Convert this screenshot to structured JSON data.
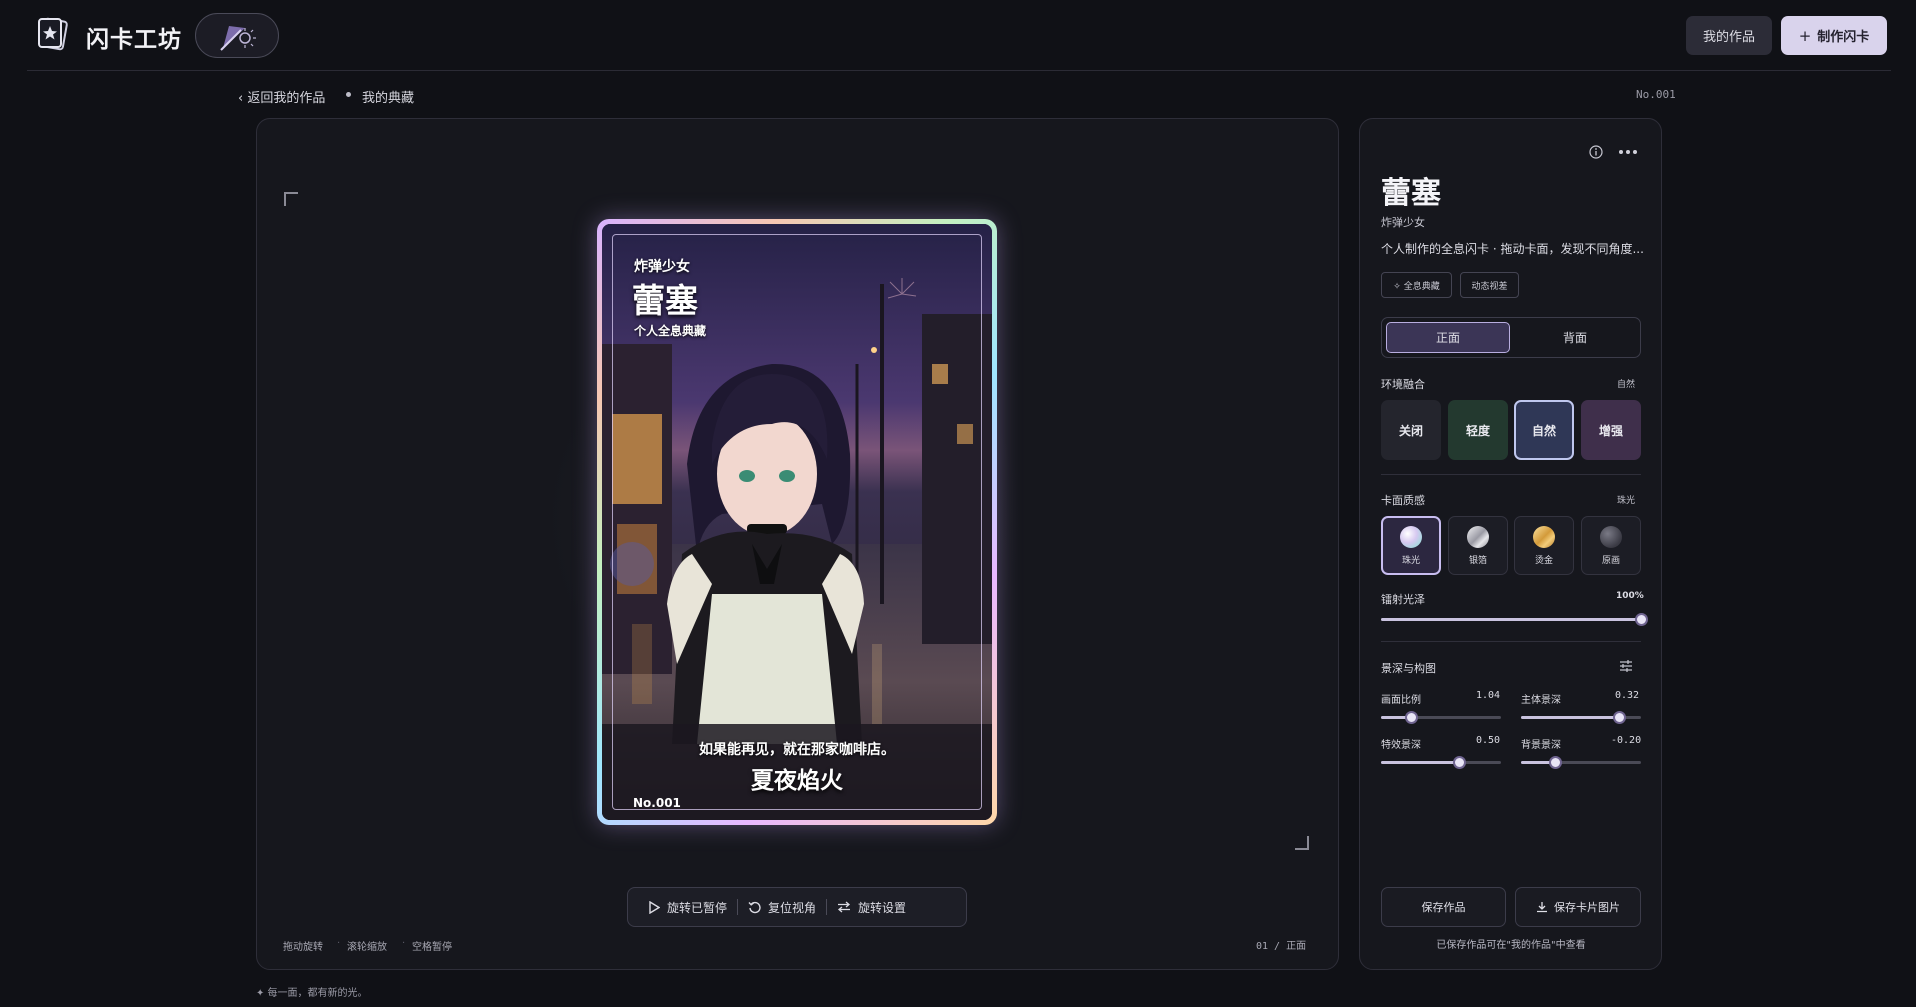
{
  "header": {
    "app_title": "闪卡工坊",
    "logo_icon": "card-star-icon",
    "theme_icon": "moon-sun-icon",
    "my_works_label": "我的作品",
    "create_label": "制作闪卡",
    "create_icon": "plus-icon"
  },
  "breadcrumb": {
    "back_label": "‹ 返回我的作品",
    "current_label": "我的典藏",
    "card_number": "No.001"
  },
  "card": {
    "subtitle": "炸弹少女",
    "name": "蕾塞",
    "collection": "个人全息典藏",
    "quote": "如果能再见，就在那家咖啡店。",
    "title": "夏夜焰火",
    "number": "No.001"
  },
  "toolbar": {
    "play_label": "旋转已暂停",
    "reset_label": "复位视角",
    "settings_label": "旋转设置"
  },
  "hints": {
    "drag": "拖动旋转",
    "scroll": "滚轮缩放",
    "space": "空格暂停",
    "sep": "·"
  },
  "page_indicator": "01 / 正面",
  "footer_tagline": "✦  每一面，都有新的光。",
  "panel": {
    "name": "蕾塞",
    "subtitle": "炸弹少女",
    "description": "个人制作的全息闪卡 · 拖动卡面，发现不同角度...",
    "tags": [
      "✧ 全息典藏",
      "动态视差"
    ],
    "side_options": [
      "正面",
      "背面"
    ],
    "side_selected": "正面",
    "env": {
      "label": "环境融合",
      "value": "自然",
      "options": [
        "关闭",
        "轻度",
        "自然",
        "增强"
      ]
    },
    "texture": {
      "label": "卡面质感",
      "value": "珠光",
      "options": [
        "珠光",
        "银箔",
        "烫金",
        "原画"
      ]
    },
    "gloss": {
      "label": "镭射光泽",
      "value": "100%",
      "fraction": 1.0
    },
    "depth": {
      "label": "景深与构图",
      "ratio": {
        "label": "画面比例",
        "value": "1.04",
        "fraction": 0.25
      },
      "subject": {
        "label": "主体景深",
        "value": "0.32",
        "fraction": 0.82
      },
      "effect": {
        "label": "特效景深",
        "value": "0.50",
        "fraction": 0.65
      },
      "background": {
        "label": "背景景深",
        "value": "-0.20",
        "fraction": 0.28
      }
    },
    "save_work_label": "保存作品",
    "save_image_label": "保存卡片图片",
    "save_note": "已保存作品可在\"我的作品\"中查看"
  },
  "colors": {
    "background": "#101116",
    "panel": "#16171d",
    "accent": "#c8bdf0",
    "create_button": "#d9d3ec"
  }
}
